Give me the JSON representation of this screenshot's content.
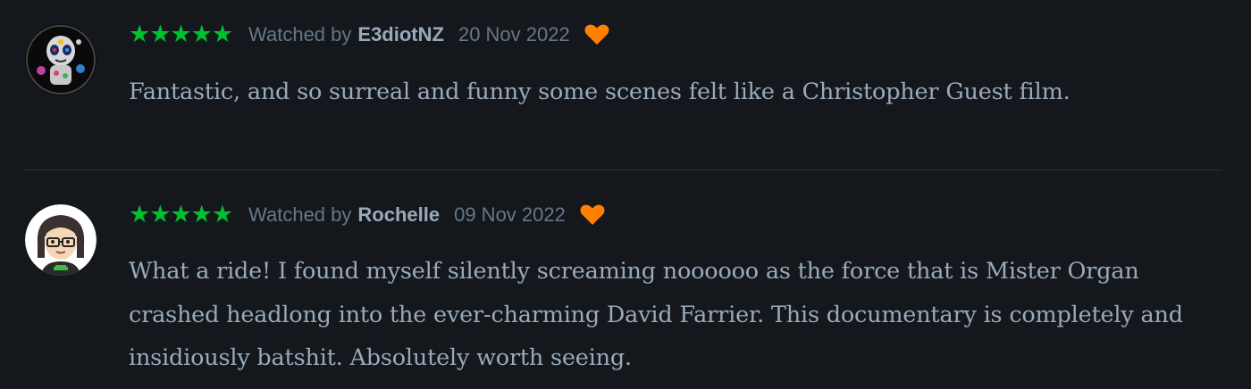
{
  "reviews": [
    {
      "stars": "★★★★★",
      "rating": 5,
      "watched_label": "Watched by",
      "username": "E3diotNZ",
      "date": "20 Nov 2022",
      "liked": true,
      "text": "Fantastic, and so surreal and funny some scenes felt like a Christopher Guest film."
    },
    {
      "stars": "★★★★★",
      "rating": 5,
      "watched_label": "Watched by",
      "username": "Rochelle",
      "date": "09 Nov 2022",
      "liked": true,
      "text": "What a ride! I found myself silently screaming noooooo as the force that is Mister Organ crashed headlong into the ever-charming David Farrier. This documentary is completely and insidiously batshit. Absolutely worth seeing."
    }
  ],
  "colors": {
    "background": "#14181c",
    "star_green": "#00c030",
    "heart_orange": "#ff8000",
    "muted_text": "#667788",
    "body_text": "#99aabb",
    "divider": "#2c3440"
  },
  "icons": {
    "rating": "star-icon",
    "like": "heart-icon"
  }
}
